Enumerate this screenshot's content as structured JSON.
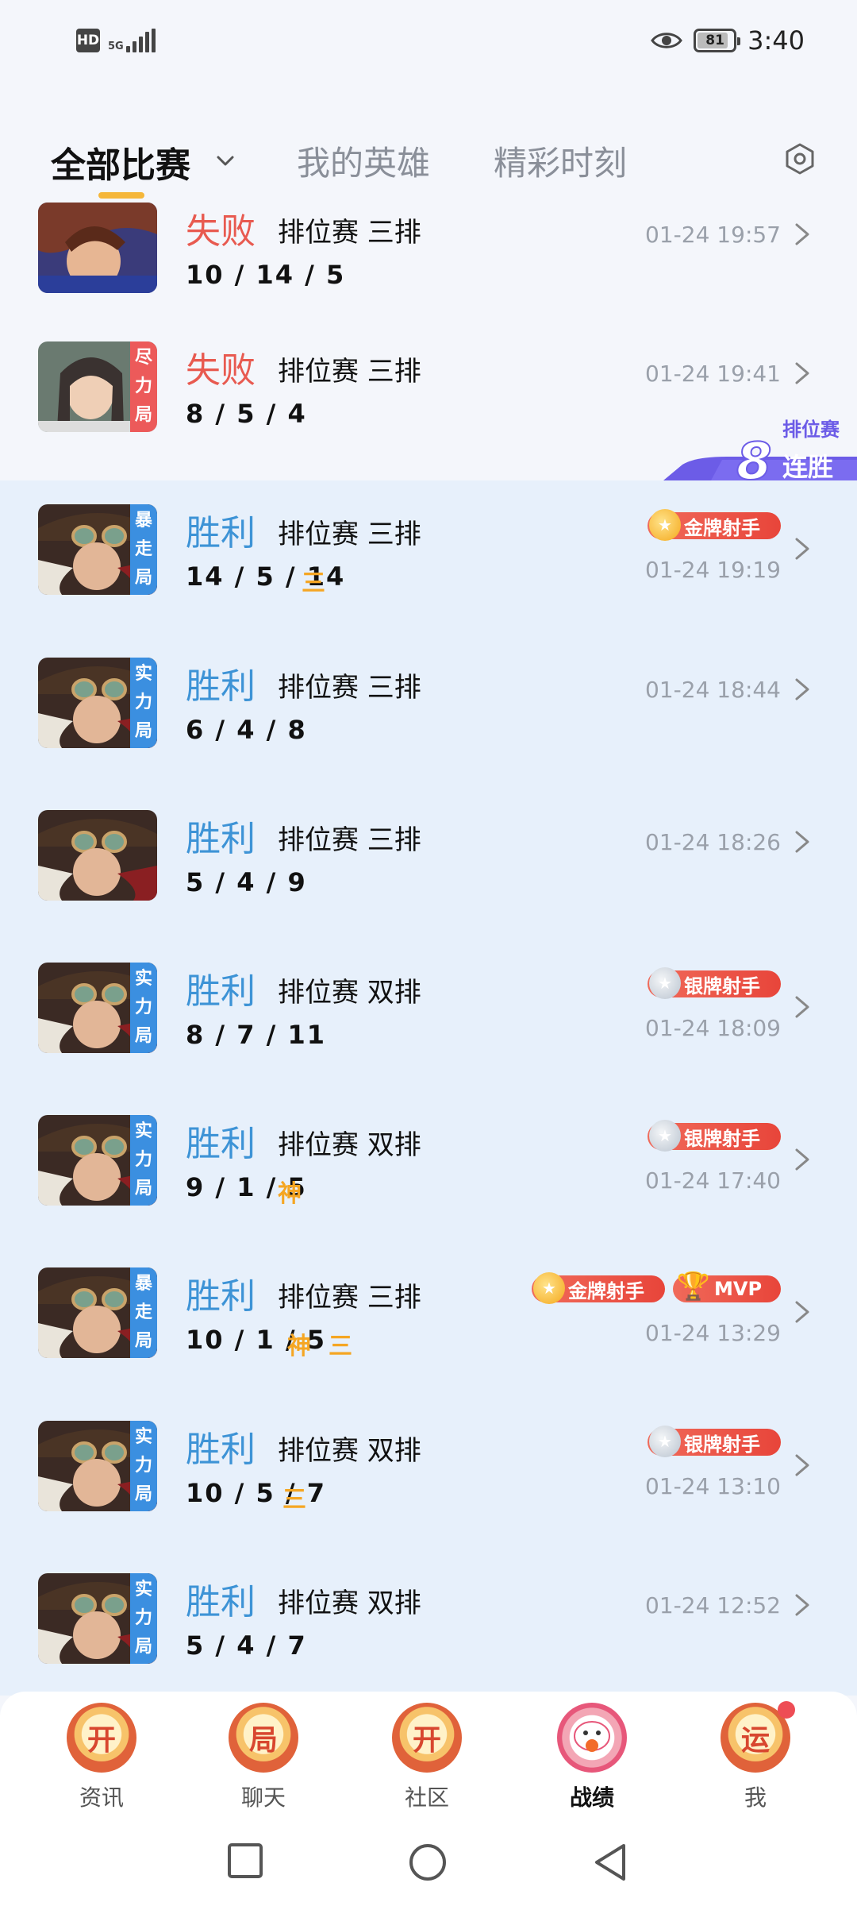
{
  "status_bar": {
    "hd": "HD",
    "network": "5G",
    "battery": "81",
    "time": "3:40",
    "icons": [
      "hd-icon",
      "signal-icon",
      "eye-icon",
      "battery-icon"
    ]
  },
  "tabs": [
    {
      "label": "全部比赛",
      "active": true
    },
    {
      "label": "我的英雄",
      "active": false
    },
    {
      "label": "精彩时刻",
      "active": false
    }
  ],
  "streak": {
    "top": "排位赛",
    "number": "8",
    "bottom": "连胜"
  },
  "matches": [
    {
      "result": "失败",
      "outcome": "loss",
      "mode": "排位赛 三排",
      "kda": "10 / 14 / 5",
      "kda_badges": [],
      "medals": [],
      "time": "01-24 19:57",
      "tag": []
    },
    {
      "result": "失败",
      "outcome": "loss",
      "mode": "排位赛 三排",
      "kda": "8 / 5 / 4",
      "kda_badges": [],
      "medals": [],
      "time": "01-24 19:41",
      "tag": [
        "尽",
        "力",
        "局"
      ]
    },
    {
      "result": "胜利",
      "outcome": "win",
      "mode": "排位赛 三排",
      "kda": "14 / 5 / 14",
      "kda_badges": [
        "三"
      ],
      "medals": [
        {
          "type": "gold",
          "label": "金牌射手"
        }
      ],
      "time": "01-24 19:19",
      "tag": [
        "暴",
        "走",
        "局"
      ]
    },
    {
      "result": "胜利",
      "outcome": "win",
      "mode": "排位赛 三排",
      "kda": "6 / 4 / 8",
      "kda_badges": [],
      "medals": [],
      "time": "01-24 18:44",
      "tag": [
        "实",
        "力",
        "局"
      ]
    },
    {
      "result": "胜利",
      "outcome": "win",
      "mode": "排位赛 三排",
      "kda": "5 / 4 / 9",
      "kda_badges": [],
      "medals": [],
      "time": "01-24 18:26",
      "tag": []
    },
    {
      "result": "胜利",
      "outcome": "win",
      "mode": "排位赛 双排",
      "kda": "8 / 7 / 11",
      "kda_badges": [],
      "medals": [
        {
          "type": "silver",
          "label": "银牌射手"
        }
      ],
      "time": "01-24 18:09",
      "tag": [
        "实",
        "力",
        "局"
      ]
    },
    {
      "result": "胜利",
      "outcome": "win",
      "mode": "排位赛 双排",
      "kda": "9 / 1 / 5",
      "kda_badges": [
        "神"
      ],
      "medals": [
        {
          "type": "silver",
          "label": "银牌射手"
        }
      ],
      "time": "01-24 17:40",
      "tag": [
        "实",
        "力",
        "局"
      ]
    },
    {
      "result": "胜利",
      "outcome": "win",
      "mode": "排位赛 三排",
      "kda": "10 / 1 / 5",
      "kda_badges": [
        "神",
        "三"
      ],
      "medals": [
        {
          "type": "gold",
          "label": "金牌射手"
        },
        {
          "type": "mvp",
          "label": "MVP"
        }
      ],
      "time": "01-24 13:29",
      "tag": [
        "暴",
        "走",
        "局"
      ]
    },
    {
      "result": "胜利",
      "outcome": "win",
      "mode": "排位赛 双排",
      "kda": "10 / 5 / 7",
      "kda_badges": [
        "三"
      ],
      "medals": [
        {
          "type": "silver",
          "label": "银牌射手"
        }
      ],
      "time": "01-24 13:10",
      "tag": [
        "实",
        "力",
        "局"
      ]
    },
    {
      "result": "胜利",
      "outcome": "win",
      "mode": "排位赛 双排",
      "kda": "5 / 4 / 7",
      "kda_badges": [],
      "medals": [],
      "time": "01-24 12:52",
      "tag": [
        "实",
        "力",
        "局"
      ]
    }
  ],
  "bottom_nav": [
    {
      "label": "资讯",
      "icon_text": "开",
      "active": false,
      "dot": false
    },
    {
      "label": "聊天",
      "icon_text": "局",
      "active": false,
      "dot": false
    },
    {
      "label": "社区",
      "icon_text": "开",
      "active": false,
      "dot": false
    },
    {
      "label": "战绩",
      "icon_text": "",
      "active": true,
      "dot": false
    },
    {
      "label": "我",
      "icon_text": "运",
      "active": false,
      "dot": true
    }
  ],
  "system_nav": [
    "recents-button",
    "home-button",
    "back-button"
  ],
  "colors": {
    "win": "#3d93d6",
    "loss": "#e85a50",
    "win_bg": "#e7f0fb",
    "accent": "#f5b73a"
  }
}
